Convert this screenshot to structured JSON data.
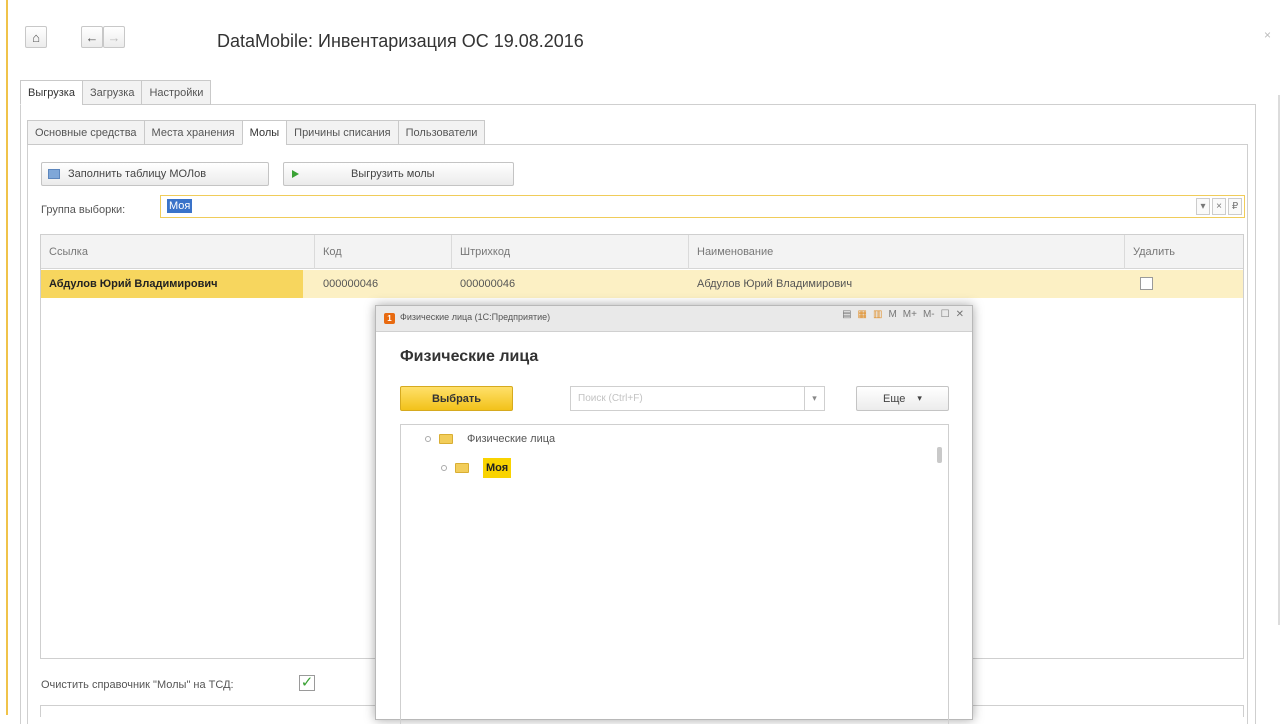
{
  "window": {
    "title": "DataMobile: Инвентаризация ОС 19.08.2016",
    "home_icon": "⌂",
    "back_icon": "←",
    "forward_icon": "→",
    "close_icon": "×"
  },
  "tabs_top": [
    "Выгрузка",
    "Загрузка",
    "Настройки"
  ],
  "tabs_sub": [
    "Основные средства",
    "Места хранения",
    "Молы",
    "Причины списания",
    "Пользователи"
  ],
  "toolbar": {
    "fill_label": "Заполнить таблицу МОЛов",
    "upload_label": "Выгрузить молы"
  },
  "group": {
    "label": "Группа выборки:",
    "value": "Моя",
    "btn_dropdown": "▾",
    "btn_clear": "×",
    "btn_link": "₽"
  },
  "table": {
    "columns": [
      "Ссылка",
      "Код",
      "Штрихкод",
      "Наименование",
      "Удалить"
    ],
    "rows": [
      {
        "link": "Абдулов Юрий Владимирович",
        "code": "000000046",
        "barcode": "000000046",
        "name": "Абдулов Юрий Владимирович",
        "delete": false
      }
    ]
  },
  "clear_ref": {
    "label": "Очистить справочник \"Молы\" на ТСД:",
    "checked": true,
    "check_mark": "✓"
  },
  "dialog": {
    "caption": "Физические лица (1С:Предприятие)",
    "heading": "Физические лица",
    "select_label": "Выбрать",
    "search_placeholder": "Поиск (Ctrl+F)",
    "search_dd": "▾",
    "more_label": "Еще",
    "more_dd": "▾",
    "controls": {
      "m": "M",
      "mplus": "M+",
      "mminus": "M-",
      "max": "☐",
      "close": "✕"
    },
    "tree": [
      {
        "label": "Физические лица",
        "level": 0
      },
      {
        "label": "Моя",
        "level": 1,
        "highlighted": true
      }
    ]
  }
}
